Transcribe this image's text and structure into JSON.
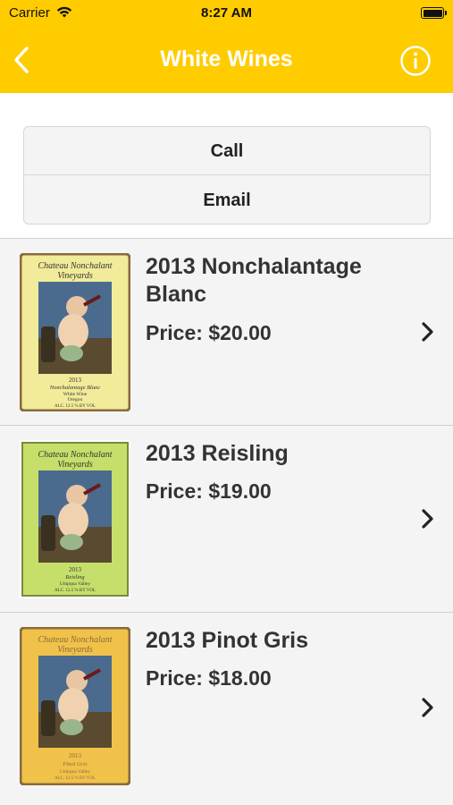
{
  "status_bar": {
    "carrier": "Carrier",
    "time": "8:27 AM"
  },
  "nav": {
    "title": "White Wines"
  },
  "contact": {
    "call_label": "Call",
    "email_label": "Email"
  },
  "wines": [
    {
      "name": "2013 Nonchalantage Blanc",
      "price": "Price: $20.00",
      "label": {
        "winery_line1": "Chateau Nonchalant",
        "winery_line2": "Vineyards",
        "year": "2013",
        "wine": "Nonchalantage Blanc",
        "type": "White Wine",
        "region": "Oregon",
        "alc": "ALC. 12.5 % BY VOL"
      }
    },
    {
      "name": "2013 Reisling",
      "price": "Price: $19.00",
      "label": {
        "winery_line1": "Chateau Nonchalant",
        "winery_line2": "Vineyards",
        "year": "2013",
        "wine": "Reisling",
        "region": "Umpqua Valley",
        "alc": "ALC. 12.5 % BY VOL"
      }
    },
    {
      "name": "2013 Pinot Gris",
      "price": "Price: $18.00",
      "label": {
        "winery_line1": "Chateau Nonchalant",
        "winery_line2": "Vineyards",
        "year": "2013",
        "wine": "Pinot Gris",
        "region": "Umpqua Valley",
        "alc": "ALC. 12.5 % BY VOL"
      }
    }
  ],
  "colors": {
    "accent": "#ffcc00",
    "label_blanc": "#f1eb9a",
    "label_reisling": "#c6df6a",
    "label_pinot": "#f0c24a",
    "label_border": "#8a6a3c"
  }
}
